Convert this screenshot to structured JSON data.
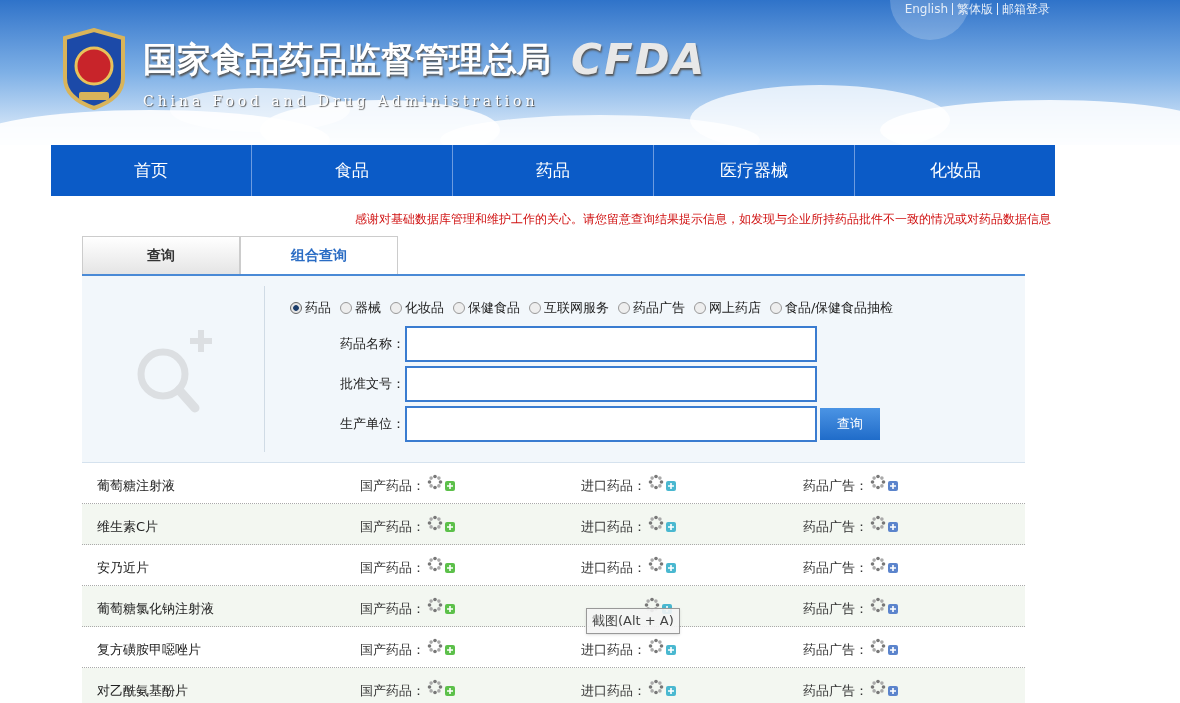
{
  "top_links": [
    "English",
    "繁体版",
    "邮箱登录"
  ],
  "header": {
    "title": "国家食品药品监督管理总局",
    "abbr": "CFDA",
    "subtitle": "China Food and Drug Administration"
  },
  "nav": [
    "首页",
    "食品",
    "药品",
    "医疗器械",
    "化妆品"
  ],
  "notice": "感谢对基础数据库管理和维护工作的关心。请您留意查询结果提示信息，如发现与企业所持药品批件不一致的情况或对药品数据信息",
  "tabs": [
    {
      "label": "查询",
      "selected": false
    },
    {
      "label": "组合查询",
      "selected": true
    }
  ],
  "categories": [
    {
      "label": "药品",
      "selected": true
    },
    {
      "label": "器械",
      "selected": false
    },
    {
      "label": "化妆品",
      "selected": false
    },
    {
      "label": "保健食品",
      "selected": false
    },
    {
      "label": "互联网服务",
      "selected": false
    },
    {
      "label": "药品广告",
      "selected": false
    },
    {
      "label": "网上药店",
      "selected": false
    },
    {
      "label": "食品/保健食品抽检",
      "selected": false
    }
  ],
  "fields": [
    {
      "label": "药品名称："
    },
    {
      "label": "批准文号："
    },
    {
      "label": "生产单位："
    }
  ],
  "search_button": "查询",
  "rows": [
    {
      "name": "葡萄糖注射液",
      "domestic": "国产药品：",
      "imported": "进口药品：",
      "ad": "药品广告："
    },
    {
      "name": "维生素C片",
      "domestic": "国产药品：",
      "imported": "进口药品：",
      "ad": "药品广告："
    },
    {
      "name": "安乃近片",
      "domestic": "国产药品：",
      "imported": "进口药品：",
      "ad": "药品广告："
    },
    {
      "name": "葡萄糖氯化钠注射液",
      "domestic": "国产药品：",
      "ad": "药品广告："
    },
    {
      "name": "复方磺胺甲噁唑片",
      "domestic": "国产药品：",
      "imported": "进口药品：",
      "ad": "药品广告："
    },
    {
      "name": "对乙酰氨基酚片",
      "domestic": "国产药品：",
      "imported": "进口药品：",
      "ad": "药品广告："
    }
  ],
  "tooltip": "截图(Alt + A)"
}
